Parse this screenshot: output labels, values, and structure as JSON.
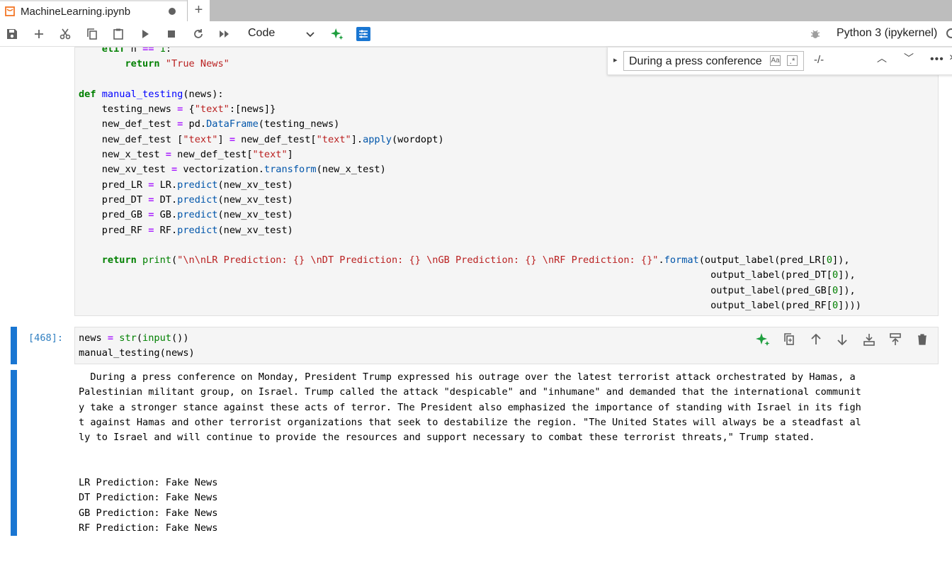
{
  "tab": {
    "title": "MachineLearning.ipynb",
    "add_label": "+"
  },
  "toolbar": {
    "cell_type": "Code",
    "kernel": "Python 3 (ipykernel)",
    "icons": [
      "save-icon",
      "add-icon",
      "cut-icon",
      "copy-icon",
      "paste-icon",
      "run-icon",
      "stop-icon",
      "restart-icon",
      "run-all-icon",
      "chevron-down-icon",
      "ai-sparkle-icon",
      "property-inspector-icon",
      "bug-icon",
      "kernel-status-icon"
    ]
  },
  "find": {
    "query": "During a press conference",
    "case_label": "Aa",
    "regex_label": ".*",
    "count": "-/-"
  },
  "cell1": {
    "lines": [
      [
        "    ",
        "elif n == 1:"
      ],
      [
        "        ",
        "return \"True News\""
      ],
      [
        "",
        ""
      ],
      [
        "",
        "def manual_testing(news):"
      ],
      [
        "    ",
        "testing_news = {\"text\":[news]}"
      ],
      [
        "    ",
        "new_def_test = pd.DataFrame(testing_news)"
      ],
      [
        "    ",
        "new_def_test [\"text\"] = new_def_test[\"text\"].apply(wordopt)"
      ],
      [
        "    ",
        "new_x_test = new_def_test[\"text\"]"
      ],
      [
        "    ",
        "new_xv_test = vectorization.transform(new_x_test)"
      ],
      [
        "    ",
        "pred_LR = LR.predict(new_xv_test)"
      ],
      [
        "    ",
        "pred_DT = DT.predict(new_xv_test)"
      ],
      [
        "    ",
        "pred_GB = GB.predict(new_xv_test)"
      ],
      [
        "    ",
        "pred_RF = RF.predict(new_xv_test)"
      ],
      [
        "",
        ""
      ],
      [
        "    ",
        "return print(\"\\n\\nLR Prediction: {} \\nDT Prediction: {} \\nGB Prediction: {} \\nRF Prediction: {}\".format(output_label(pred_LR[0]),"
      ],
      [
        "                                                                                                             ",
        "output_label(pred_DT[0]),"
      ],
      [
        "                                                                                                             ",
        "output_label(pred_GB[0]),"
      ],
      [
        "                                                                                                             ",
        "output_label(pred_RF[0])))"
      ]
    ]
  },
  "cell2": {
    "prompt": "[468]:",
    "line1": "news = str(input())",
    "line2": "manual_testing(news)"
  },
  "output": {
    "text": "  During a press conference on Monday, President Trump expressed his outrage over the latest terrorist attack orchestrated by Hamas, a\nPalestinian militant group, on Israel. Trump called the attack \"despicable\" and \"inhumane\" and demanded that the international communit\ny take a stronger stance against these acts of terror. The President also emphasized the importance of standing with Israel in its figh\nt against Hamas and other terrorist organizations that seek to destabilize the region. \"The United States will always be a steadfast al\nly to Israel and will continue to provide the resources and support necessary to combat these terrorist threats,\" Trump stated.\n\n\nLR Prediction: Fake News\nDT Prediction: Fake News\nGB Prediction: Fake News\nRF Prediction: Fake News"
  }
}
